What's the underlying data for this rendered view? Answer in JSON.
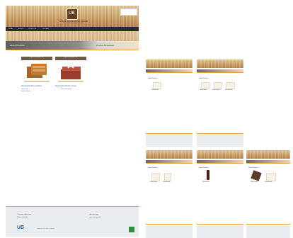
{
  "main": {
    "brand_logo_text": "UB",
    "brand_name": "STEAK HARVESTER WOOD",
    "tagline": "Handcrafted wooden products",
    "nav_items": [
      "HOME",
      "ABOUT",
      "PRODUCTS",
      "CONTACT"
    ],
    "section_title": "Wood Products",
    "section_tab": "Product Showcase",
    "products": [
      {
        "head": "WOOD PRODUCTS",
        "name": "Rectangular Block of Wood",
        "sub": "Learn more",
        "sub2": "Product details"
      },
      {
        "head": "WOOD PRODUCTS",
        "name": "Rectangular Wooden Tissue",
        "sub": "Tissue box cover"
      }
    ],
    "footer": {
      "left_lines": [
        "Company address line",
        "Phone and email"
      ],
      "right_lines": [
        "Opening hours",
        "Terms and privacy"
      ],
      "logo": "UB",
      "copyright": "Copyright all rights reserved"
    }
  },
  "thumbnails": [
    {
      "title": "Wood Products",
      "items": [
        "Wood block"
      ]
    },
    {
      "title": "Wood Products",
      "items": [
        "Wood block",
        "Wood block",
        "Wood block"
      ]
    },
    {
      "title": "Wood Products",
      "items": [
        "Wood block",
        "Wood block"
      ]
    },
    {
      "title": "Wood Products",
      "items": [
        "Wine bottle"
      ]
    },
    {
      "title": "Wood Products",
      "items": [
        "Wood block",
        "Wood block"
      ]
    }
  ]
}
